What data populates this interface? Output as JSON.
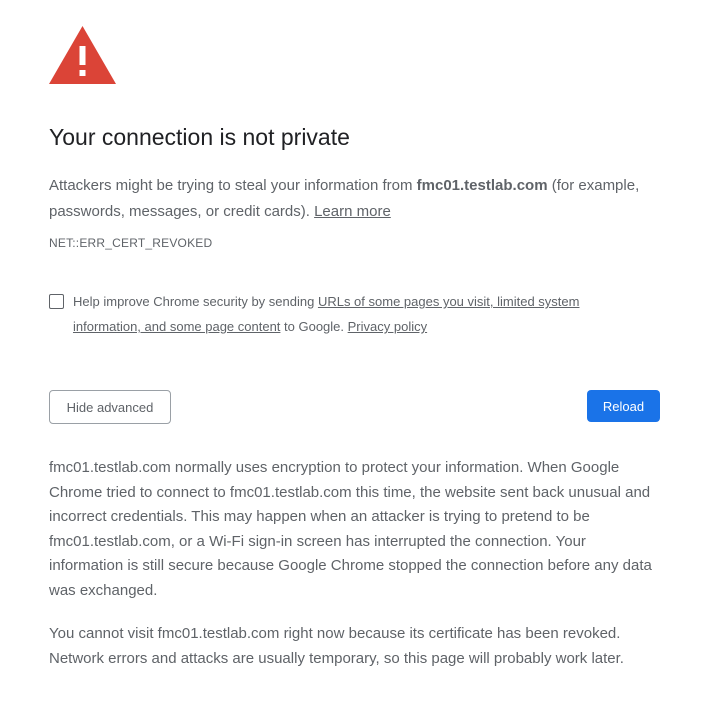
{
  "page": {
    "icon": "warning-triangle-icon",
    "title": "Your connection is not private",
    "main_message_prefix": "Attackers might be trying to steal your information from ",
    "host": "fmc01.testlab.com",
    "main_message_suffix": " (for example, passwords, messages, or credit cards). ",
    "learn_more": "Learn more",
    "error_code": "NET::ERR_CERT_REVOKED"
  },
  "opt_in": {
    "text_prefix": "Help improve Chrome security by sending ",
    "link_urls": "URLs of some pages you visit, limited system information, and some page content",
    "text_middle": " to Google. ",
    "privacy_link": "Privacy policy",
    "checked": false
  },
  "buttons": {
    "hide_advanced": "Hide advanced",
    "reload": "Reload"
  },
  "details": {
    "paragraph1": "fmc01.testlab.com normally uses encryption to protect your information. When Google Chrome tried to connect to fmc01.testlab.com this time, the website sent back unusual and incorrect credentials. This may happen when an attacker is trying to pretend to be fmc01.testlab.com, or a Wi-Fi sign-in screen has interrupted the connection. Your information is still secure because Google Chrome stopped the connection before any data was exchanged.",
    "paragraph2": "You cannot visit fmc01.testlab.com right now because its certificate has been revoked. Network errors and attacks are usually temporary, so this page will probably work later."
  },
  "colors": {
    "warning_red": "#db4437",
    "reload_blue": "#1a73e8",
    "body_text": "#5f6368",
    "title_text": "#202124"
  }
}
